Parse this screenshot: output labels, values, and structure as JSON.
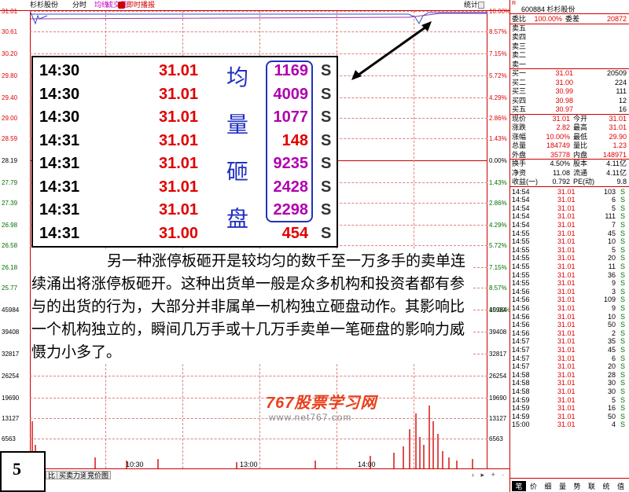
{
  "topbar": {
    "name": "杉杉股份",
    "period": "分时",
    "avg": "均线",
    "vol": "成交量",
    "replay": "即时播报",
    "stat": "统计"
  },
  "axis_left": [
    "31.01",
    "30.61",
    "30.20",
    "29.80",
    "29.40",
    "29.00",
    "28.59",
    "28.19",
    "27.79",
    "27.39",
    "26.98",
    "26.58",
    "26.18",
    "25.77",
    "45984",
    "39408",
    "32817",
    "26254",
    "19690",
    "13127",
    "6563"
  ],
  "axis_right": [
    "10.00%",
    "8.57%",
    "7.15%",
    "5.72%",
    "4.29%",
    "2.86%",
    "1.43%",
    "0.00%",
    "1.43%",
    "2.86%",
    "4.29%",
    "5.72%",
    "7.15%",
    "8.57%",
    "10.00%",
    "45984",
    "39408",
    "32817",
    "26254",
    "19690",
    "13127",
    "6563"
  ],
  "x_axis": [
    "10:30",
    "13:00",
    "14:00"
  ],
  "bottom_tabs": [
    "比",
    "买卖力道",
    "竞价图"
  ],
  "slide_number": "5",
  "trades": [
    {
      "time": "14:30",
      "price": "31.01",
      "vol": "1169",
      "side": "S",
      "vol_color": "purple"
    },
    {
      "time": "14:30",
      "price": "31.01",
      "vol": "4009",
      "side": "S",
      "vol_color": "purple"
    },
    {
      "time": "14:30",
      "price": "31.01",
      "vol": "1077",
      "side": "S",
      "vol_color": "purple"
    },
    {
      "time": "14:31",
      "price": "31.01",
      "vol": "148",
      "side": "S",
      "vol_color": "red"
    },
    {
      "time": "14:31",
      "price": "31.01",
      "vol": "9235",
      "side": "S",
      "vol_color": "purple"
    },
    {
      "time": "14:31",
      "price": "31.01",
      "vol": "2428",
      "side": "S",
      "vol_color": "purple"
    },
    {
      "time": "14:31",
      "price": "31.01",
      "vol": "2298",
      "side": "S",
      "vol_color": "purple"
    },
    {
      "time": "14:31",
      "price": "31.00",
      "vol": "454",
      "side": "S",
      "vol_color": "red"
    }
  ],
  "vertical_label": [
    "均",
    "量",
    "砸",
    "盘"
  ],
  "paragraph": "另一种涨停板砸开是较均匀的数千至一万多手的卖单连续涌出将涨停板砸开。这种出货单一般是众多机构和投资者都有参与的出货的行为，大部分并非属单一机构独立砸盘动作。其影响比一个机构独立的，瞬间几万手或十几万手卖单一笔砸盘的影响力威慑力小多了。",
  "watermark": {
    "logo": "767股票学习网",
    "url": "www.net767.com"
  },
  "panel": {
    "r_mark": "R",
    "code": "600884 杉杉股份",
    "weibi_label": "委比",
    "weibi": "100.00%",
    "weicha_label": "委差",
    "weicha": "20872",
    "sell": [
      {
        "label": "卖五",
        "price": "",
        "vol": ""
      },
      {
        "label": "卖四",
        "price": "",
        "vol": ""
      },
      {
        "label": "卖三",
        "price": "",
        "vol": ""
      },
      {
        "label": "卖二",
        "price": "",
        "vol": ""
      },
      {
        "label": "卖一",
        "price": "",
        "vol": ""
      }
    ],
    "buy": [
      {
        "label": "买一",
        "price": "31.01",
        "vol": "20509"
      },
      {
        "label": "买二",
        "price": "31.00",
        "vol": "224"
      },
      {
        "label": "买三",
        "price": "30.99",
        "vol": "111"
      },
      {
        "label": "买四",
        "price": "30.98",
        "vol": "12"
      },
      {
        "label": "买五",
        "price": "30.97",
        "vol": "16"
      }
    ],
    "stats": [
      {
        "l1": "现价",
        "v1": "31.01",
        "l2": "今开",
        "v2": "31.01"
      },
      {
        "l1": "涨跌",
        "v1": "2.82",
        "l2": "最高",
        "v2": "31.01"
      },
      {
        "l1": "涨幅",
        "v1": "10.00%",
        "l2": "最低",
        "v2": "29.90"
      },
      {
        "l1": "总量",
        "v1": "184749",
        "l2": "量比",
        "v2": "1.23"
      },
      {
        "l1": "外盘",
        "v1": "35778",
        "l2": "内盘",
        "v2": "148971"
      }
    ],
    "stats2": [
      {
        "l1": "换手",
        "v1": "4.50%",
        "l2": "股本",
        "v2": "4.11亿"
      },
      {
        "l1": "净资",
        "v1": "11.08",
        "l2": "流通",
        "v2": "4.11亿"
      },
      {
        "l1": "收益(一)",
        "v1": "0.792",
        "l2": "PE(动)",
        "v2": "9.8"
      }
    ],
    "ticks": [
      [
        "14:54",
        "31.01",
        "103",
        "S"
      ],
      [
        "14:54",
        "31.01",
        "6",
        "S"
      ],
      [
        "14:54",
        "31.01",
        "5",
        "S"
      ],
      [
        "14:54",
        "31.01",
        "111",
        "S"
      ],
      [
        "14:54",
        "31.01",
        "7",
        "S"
      ],
      [
        "14:55",
        "31.01",
        "45",
        "S"
      ],
      [
        "14:55",
        "31.01",
        "10",
        "S"
      ],
      [
        "14:55",
        "31.01",
        "5",
        "S"
      ],
      [
        "14:55",
        "31.01",
        "20",
        "S"
      ],
      [
        "14:55",
        "31.01",
        "11",
        "S"
      ],
      [
        "14:55",
        "31.01",
        "36",
        "S"
      ],
      [
        "14:55",
        "31.01",
        "9",
        "S"
      ],
      [
        "14:56",
        "31.01",
        "3",
        "S"
      ],
      [
        "14:56",
        "31.01",
        "109",
        "S"
      ],
      [
        "14:56",
        "31.01",
        "9",
        "S"
      ],
      [
        "14:56",
        "31.01",
        "10",
        "S"
      ],
      [
        "14:56",
        "31.01",
        "50",
        "S"
      ],
      [
        "14:56",
        "31.01",
        "2",
        "S"
      ],
      [
        "14:57",
        "31.01",
        "35",
        "S"
      ],
      [
        "14:57",
        "31.01",
        "45",
        "S"
      ],
      [
        "14:57",
        "31.01",
        "6",
        "S"
      ],
      [
        "14:57",
        "31.01",
        "20",
        "S"
      ],
      [
        "14:58",
        "31.01",
        "28",
        "S"
      ],
      [
        "14:58",
        "31.01",
        "30",
        "S"
      ],
      [
        "14:58",
        "31.01",
        "30",
        "S"
      ],
      [
        "14:59",
        "31.01",
        "5",
        "S"
      ],
      [
        "14:59",
        "31.01",
        "16",
        "S"
      ],
      [
        "14:59",
        "31.01",
        "50",
        "S"
      ],
      [
        "15:00",
        "31.01",
        "4",
        "S"
      ]
    ],
    "tabs": [
      "笔",
      "价",
      "细",
      "量",
      "势",
      "联",
      "统",
      "值"
    ]
  }
}
